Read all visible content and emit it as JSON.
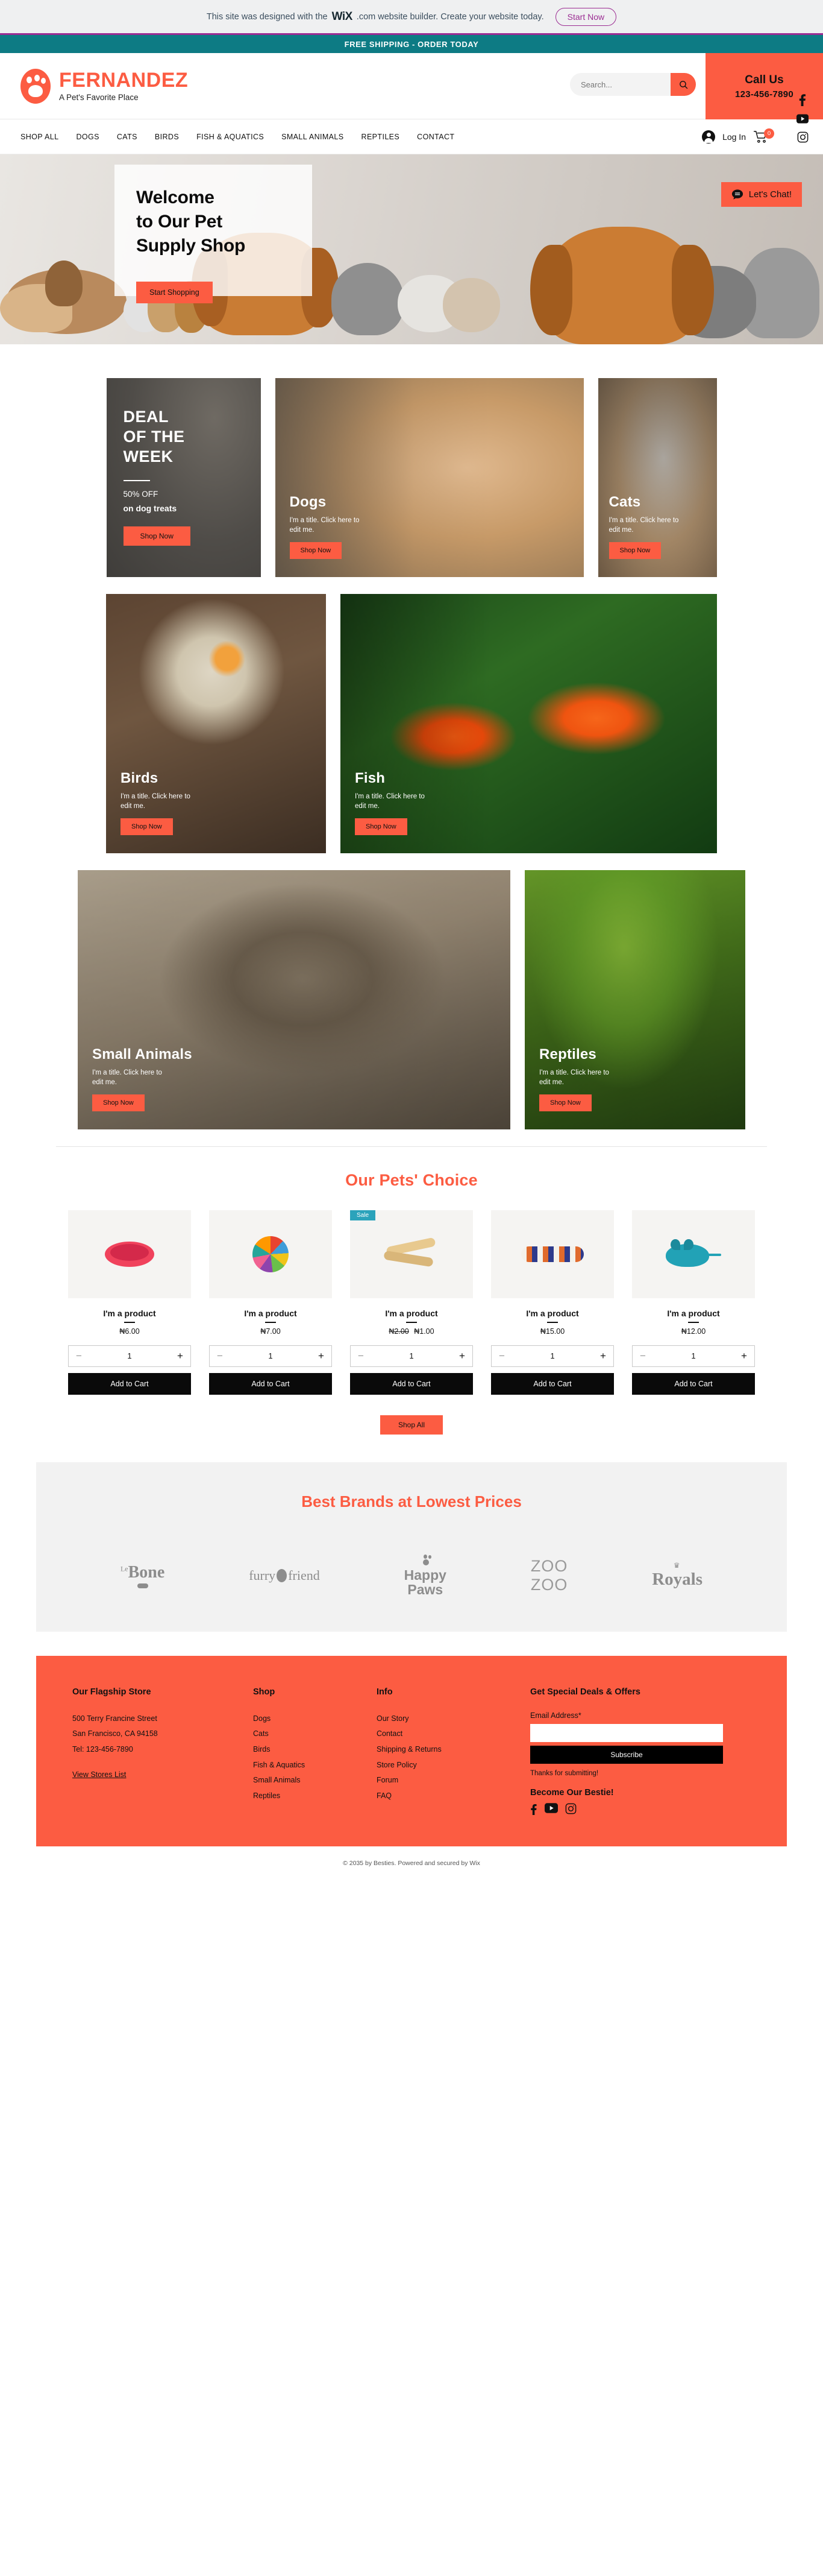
{
  "wix_banner": {
    "text_before": "This site was designed with the",
    "logo": "WiX",
    "text_after": ".com website builder. Create your website today.",
    "cta": "Start Now"
  },
  "promo": {
    "text": "FREE SHIPPING - ORDER TODAY"
  },
  "header": {
    "brand_name": "FERNANDEZ",
    "tagline": "A Pet's Favorite Place",
    "search_placeholder": "Search...",
    "search_value": "",
    "call_label": "Call Us",
    "call_number": "123-456-7890",
    "accent": "#fc5c42",
    "teal": "#0d7b84"
  },
  "nav": {
    "items": [
      {
        "label": "SHOP ALL"
      },
      {
        "label": "DOGS"
      },
      {
        "label": "CATS"
      },
      {
        "label": "BIRDS"
      },
      {
        "label": "FISH & AQUATICS"
      },
      {
        "label": "SMALL ANIMALS"
      },
      {
        "label": "REPTILES"
      },
      {
        "label": "CONTACT"
      }
    ],
    "login_label": "Log In",
    "cart_count": "0"
  },
  "hero": {
    "title_line1": "Welcome",
    "title_line2": "to Our Pet",
    "title_line3": "Supply Shop",
    "cta": "Start Shopping",
    "chat": "Let's Chat!"
  },
  "deal": {
    "line1": "DEAL",
    "line2": "OF THE",
    "line3": "WEEK",
    "percent": "50% OFF",
    "sub": "on dog treats",
    "cta": "Shop Now"
  },
  "categories": [
    {
      "name": "Dogs",
      "desc": "I'm a title. Click here to edit me.",
      "cta": "Shop Now"
    },
    {
      "name": "Cats",
      "desc": "I'm a title. Click here to edit me.",
      "cta": "Shop Now"
    },
    {
      "name": "Birds",
      "desc": "I'm a title. Click here to edit me.",
      "cta": "Shop Now"
    },
    {
      "name": "Fish",
      "desc": "I'm a title. Click here to edit me.",
      "cta": "Shop Now"
    },
    {
      "name": "Small Animals",
      "desc": "I'm a title. Click here to edit me.",
      "cta": "Shop Now"
    },
    {
      "name": "Reptiles",
      "desc": "I'm a title. Click here to edit me.",
      "cta": "Shop Now"
    }
  ],
  "products_section": {
    "title": "Our Pets' Choice",
    "shop_all": "Shop All",
    "add_to_cart": "Add to Cart",
    "sale_badge": "Sale",
    "items": [
      {
        "name": "I'm a product",
        "price": "₦6.00",
        "old_price": "",
        "qty": "1",
        "sale": false
      },
      {
        "name": "I'm a product",
        "price": "₦7.00",
        "old_price": "",
        "qty": "1",
        "sale": false
      },
      {
        "name": "I'm a product",
        "price": "₦1.00",
        "old_price": "₦2.00",
        "qty": "1",
        "sale": true
      },
      {
        "name": "I'm a product",
        "price": "₦15.00",
        "old_price": "",
        "qty": "1",
        "sale": false
      },
      {
        "name": "I'm a product",
        "price": "₦12.00",
        "old_price": "",
        "qty": "1",
        "sale": false
      }
    ]
  },
  "brands": {
    "title": "Best Brands at Lowest Prices",
    "logos": [
      {
        "name": "Le Bone",
        "sup": "Le",
        "main": "Bone"
      },
      {
        "name": "furry friend",
        "sup": "",
        "main": "furry friend"
      },
      {
        "name": "Happy Paws",
        "sup": "",
        "main": "Happy Paws"
      },
      {
        "name": "ZOO ZOO",
        "sup": "",
        "main": "ZOO ZOO"
      },
      {
        "name": "Royals",
        "sup": "",
        "main": "Royals"
      }
    ]
  },
  "footer": {
    "store": {
      "heading": "Our Flagship Store",
      "address1": "500 Terry Francine Street",
      "address2": "San Francisco, CA 94158",
      "tel": "Tel: 123-456-7890",
      "stores_link": "View Stores List"
    },
    "shop": {
      "heading": "Shop",
      "links": [
        "Dogs",
        "Cats",
        "Birds",
        "Fish & Aquatics",
        "Small Animals",
        "Reptiles"
      ]
    },
    "info": {
      "heading": "Info",
      "links": [
        "Our Story",
        "Contact",
        "Shipping & Returns",
        "Store Policy",
        "Forum",
        "FAQ"
      ]
    },
    "newsletter": {
      "heading": "Get Special Deals & Offers",
      "email_label": "Email Address*",
      "email_value": "",
      "email_placeholder": "",
      "subscribe": "Subscribe",
      "thanks": "Thanks for submitting!",
      "bestie": "Become Our Bestie!"
    },
    "copyright_before": "© 2035 by Besties. Powered and secured by ",
    "copyright_link": "Wix"
  }
}
